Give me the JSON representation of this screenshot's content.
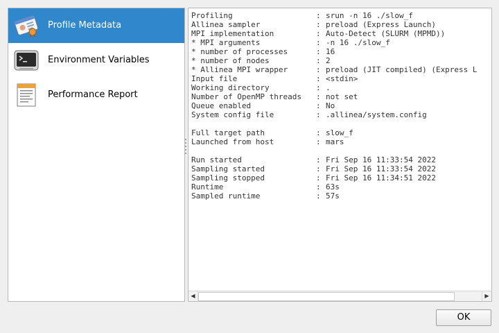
{
  "sidebar": {
    "items": [
      {
        "label": "Profile Metadata",
        "icon": "id-card-icon",
        "selected": true
      },
      {
        "label": "Environment Variables",
        "icon": "terminal-icon",
        "selected": false
      },
      {
        "label": "Performance Report",
        "icon": "document-icon",
        "selected": false
      }
    ]
  },
  "metadata": {
    "separator": ":",
    "rows": [
      {
        "key": "Profiling",
        "value": "srun -n 16 ./slow_f"
      },
      {
        "key": "Allinea sampler",
        "value": "preload (Express Launch)"
      },
      {
        "key": "MPI implementation",
        "value": "Auto-Detect (SLURM (MPMD))"
      },
      {
        "key": "* MPI arguments",
        "value": "-n 16 ./slow_f"
      },
      {
        "key": "* number of processes",
        "value": "16"
      },
      {
        "key": "* number of nodes",
        "value": "2"
      },
      {
        "key": "* Allinea MPI wrapper",
        "value": "preload (JIT compiled) (Express L"
      },
      {
        "key": "Input file",
        "value": "<stdin>"
      },
      {
        "key": "Working directory",
        "value": "."
      },
      {
        "key": "Number of OpenMP threads",
        "value": "not set"
      },
      {
        "key": "Queue enabled",
        "value": "No"
      },
      {
        "key": "System config file",
        "value": ".allinea/system.config"
      },
      {
        "blank": true
      },
      {
        "key": "Full target path",
        "value": "slow_f"
      },
      {
        "key": "Launched from host",
        "value": "mars"
      },
      {
        "blank": true
      },
      {
        "key": "Run started",
        "value": "Fri Sep 16 11:33:54 2022"
      },
      {
        "key": "Sampling started",
        "value": "Fri Sep 16 11:33:54 2022"
      },
      {
        "key": "Sampling stopped",
        "value": "Fri Sep 16 11:34:51 2022"
      },
      {
        "key": "Runtime",
        "value": "63s"
      },
      {
        "key": "Sampled runtime",
        "value": "57s"
      }
    ]
  },
  "scrollbar": {
    "left_arrow": "◀",
    "right_arrow": "▶"
  },
  "buttons": {
    "ok_label": "OK"
  },
  "colors": {
    "selection": "#3087cc",
    "background": "#efefef"
  }
}
